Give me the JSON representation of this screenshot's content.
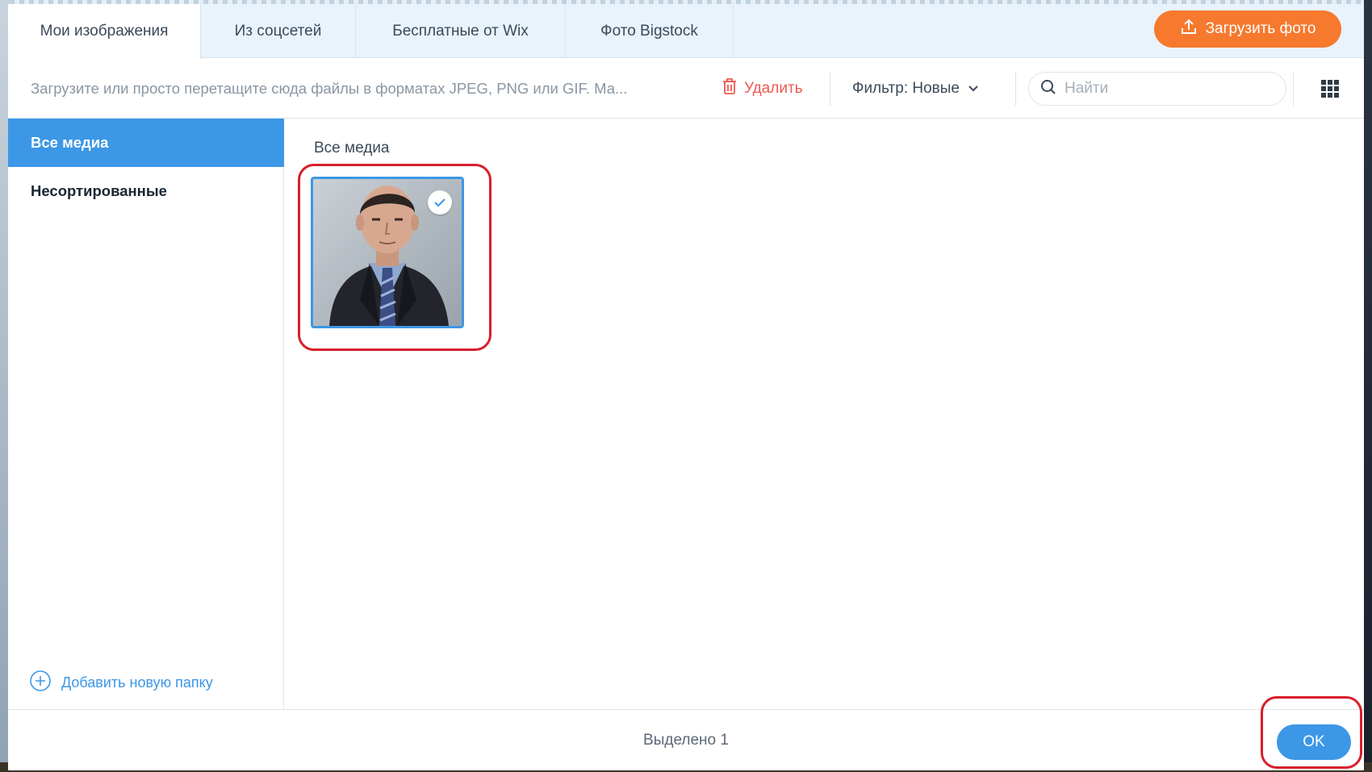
{
  "tabs": [
    {
      "label": "Мои изображения",
      "active": true
    },
    {
      "label": "Из соцсетей",
      "active": false
    },
    {
      "label": "Бесплатные от Wix",
      "active": false
    },
    {
      "label": "Фото Bigstock",
      "active": false
    }
  ],
  "upload_button": {
    "label": "Загрузить фото",
    "icon": "upload-icon",
    "color": "#f6792e"
  },
  "toolbar": {
    "hint": "Загрузите или просто перетащите сюда файлы в форматах JPEG, PNG или GIF. Ма...",
    "delete_label": "Удалить",
    "filter_label": "Фильтр: Новые",
    "search_placeholder": "Найти",
    "view_icon": "grid-view-icon"
  },
  "sidebar": {
    "items": [
      {
        "label": "Все медиа",
        "active": true
      },
      {
        "label": "Несортированные",
        "active": false
      }
    ],
    "add_folder_label": "Добавить новую папку"
  },
  "main": {
    "section_title": "Все медиа",
    "media": [
      {
        "kind": "portrait-photo",
        "selected": true
      }
    ]
  },
  "footer": {
    "selected_text": "Выделено 1",
    "ok_label": "OK"
  },
  "colors": {
    "accent": "#3c97e6",
    "upload": "#f6792e",
    "delete": "#ee5951",
    "highlight": "#d81f2b"
  }
}
